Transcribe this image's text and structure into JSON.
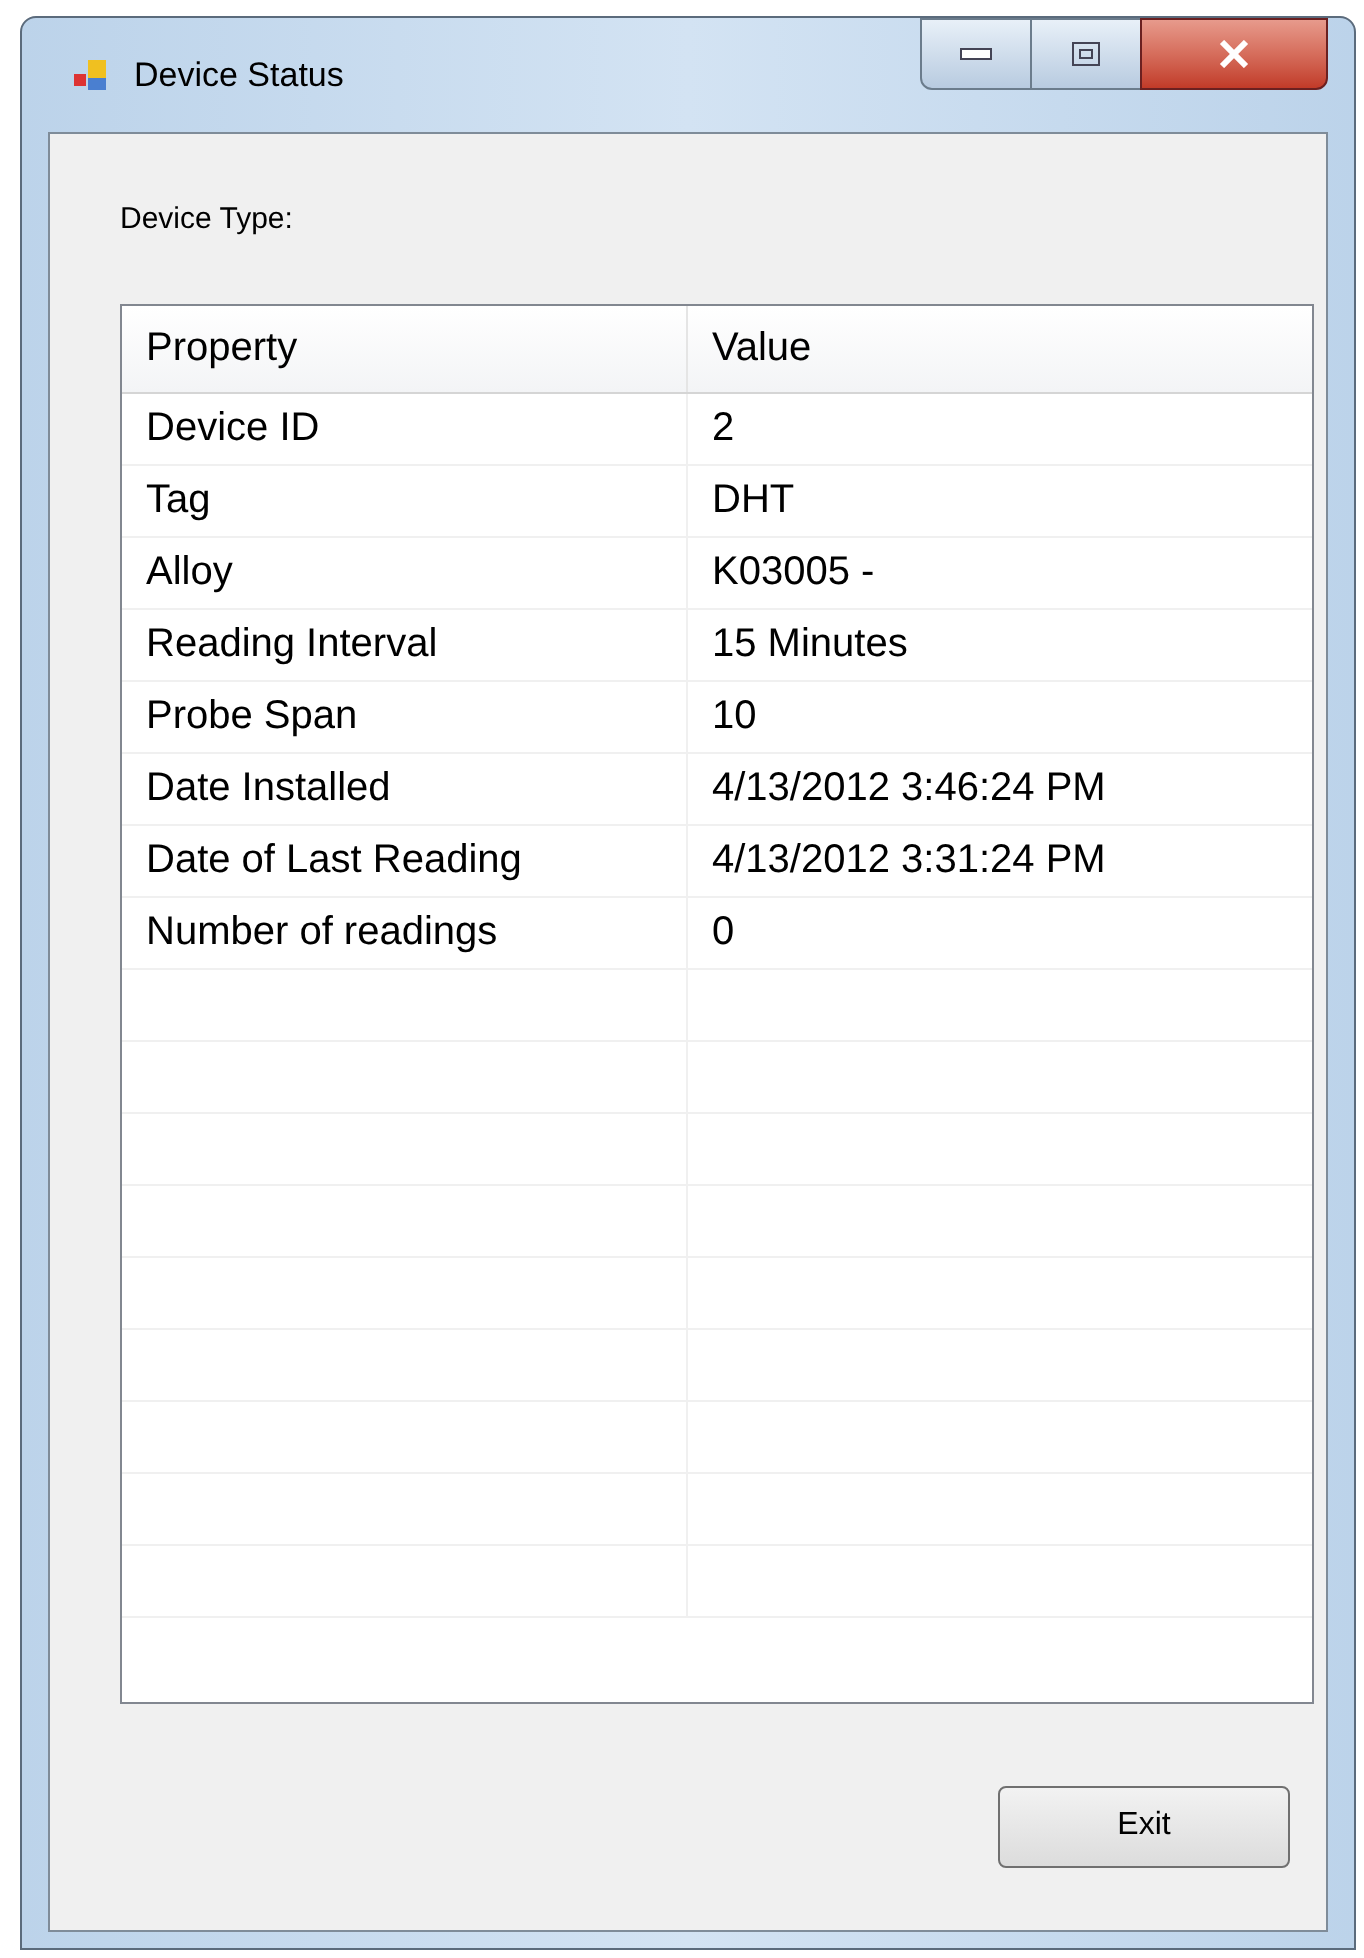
{
  "window": {
    "title": "Device Status"
  },
  "device_type_label": "Device Type:",
  "table": {
    "columns": [
      "Property",
      "Value"
    ],
    "rows": [
      [
        "Device ID",
        "2"
      ],
      [
        "Tag",
        "DHT"
      ],
      [
        "Alloy",
        "K03005 -"
      ],
      [
        "Reading Interval",
        "15 Minutes"
      ],
      [
        "Probe Span",
        "10"
      ],
      [
        "Date Installed",
        "4/13/2012 3:46:24 PM"
      ],
      [
        "Date of Last Reading",
        "4/13/2012 3:31:24 PM"
      ],
      [
        "Number of readings",
        "0"
      ]
    ]
  },
  "buttons": [
    "Exit"
  ]
}
